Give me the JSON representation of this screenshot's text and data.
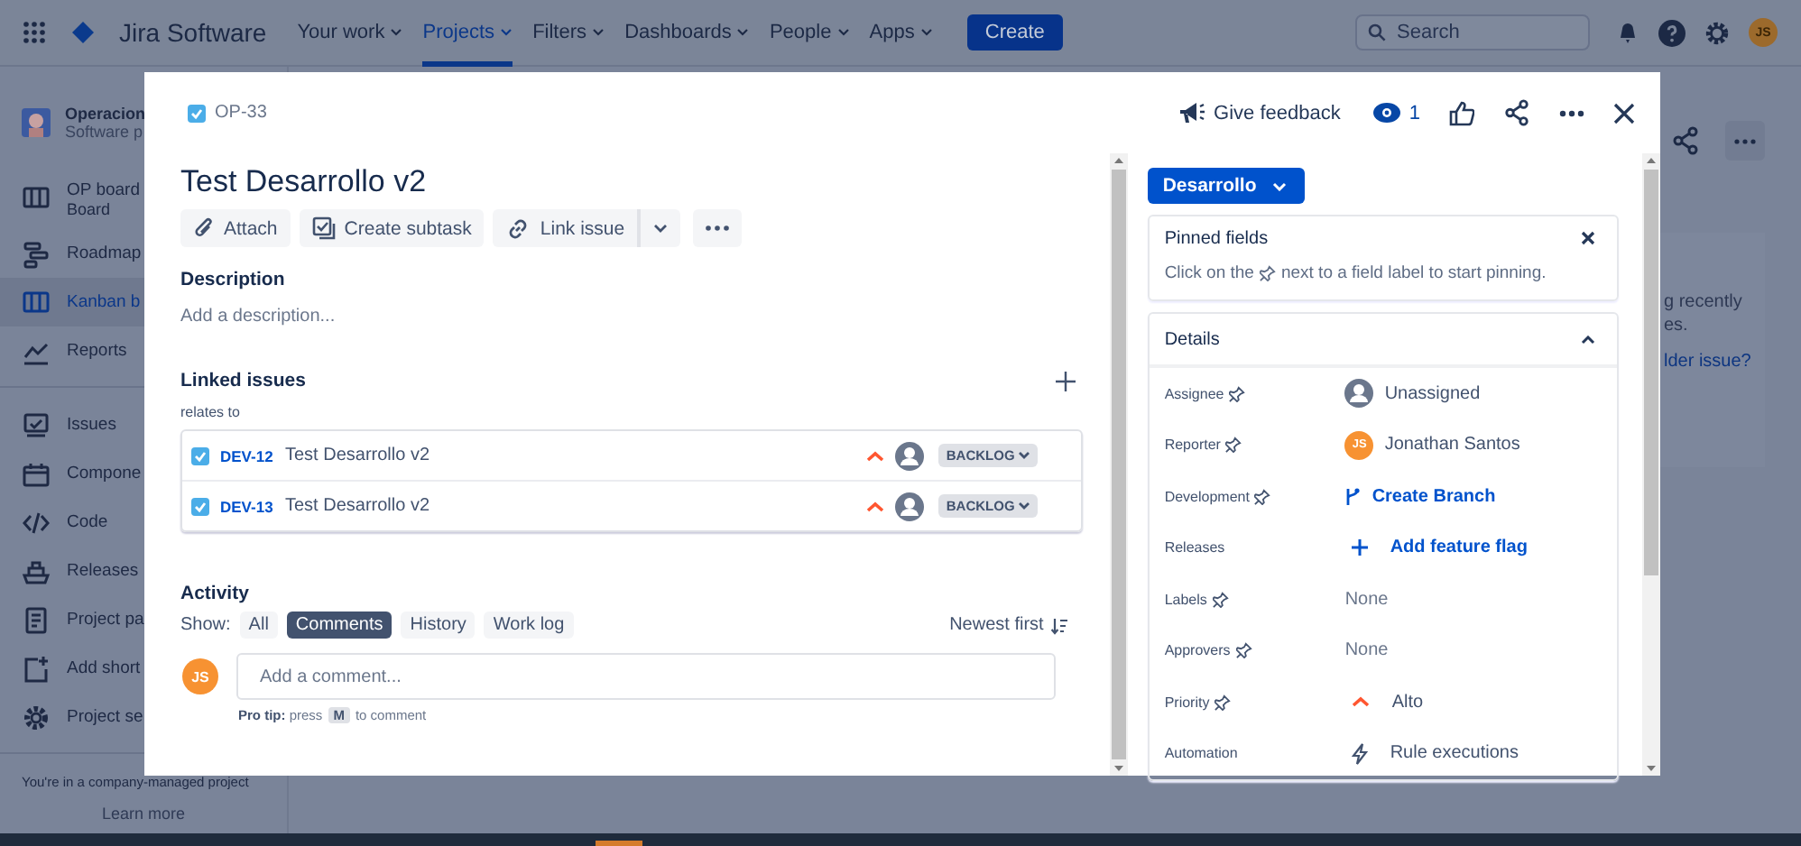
{
  "nav": {
    "logo": "Jira Software",
    "items": [
      {
        "label": "Your work",
        "selected": false
      },
      {
        "label": "Projects",
        "selected": true
      },
      {
        "label": "Filters",
        "selected": false
      },
      {
        "label": "Dashboards",
        "selected": false
      },
      {
        "label": "People",
        "selected": false
      },
      {
        "label": "Apps",
        "selected": false
      }
    ],
    "create": "Create",
    "search": {
      "placeholder": "Search"
    },
    "avatar": "JS"
  },
  "sidebar": {
    "project": {
      "name": "Operacion",
      "type": "Software p"
    },
    "sections": [
      {
        "items": [
          {
            "label": "OP board",
            "sublabel": "Board",
            "selected": false
          },
          {
            "label": "Roadmap",
            "selected": false
          },
          {
            "label": "Kanban b",
            "selected": true
          },
          {
            "label": "Reports",
            "selected": false
          }
        ]
      },
      {
        "items": [
          {
            "label": "Issues",
            "selected": false
          },
          {
            "label": "Compone",
            "selected": false
          },
          {
            "label": "Code",
            "selected": false
          },
          {
            "label": "Releases",
            "selected": false
          },
          {
            "label": "Project pa",
            "selected": false
          },
          {
            "label": "Add short",
            "selected": false
          },
          {
            "label": "Project se",
            "selected": false
          }
        ]
      }
    ],
    "footer": "You're in a company-managed project",
    "learn_more": "Learn more"
  },
  "backdrop_panel": {
    "lines": [
      "g recently",
      "es."
    ],
    "link": "lder issue?"
  },
  "modal": {
    "issue_key": "OP-33",
    "feedback": "Give feedback",
    "watchers": "1",
    "title": "Test Desarrollo v2",
    "actions": [
      "Attach",
      "Create subtask",
      "Link issue"
    ],
    "description": {
      "heading": "Description",
      "placeholder": "Add a description..."
    },
    "linked": {
      "heading": "Linked issues",
      "relation": "relates to",
      "issues": [
        {
          "key": "DEV-12",
          "summary": "Test Desarrollo v2",
          "status": "BACKLOG"
        },
        {
          "key": "DEV-13",
          "summary": "Test Desarrollo v2",
          "status": "BACKLOG"
        }
      ]
    },
    "activity": {
      "heading": "Activity",
      "show_label": "Show:",
      "filters": [
        {
          "label": "All",
          "selected": false
        },
        {
          "label": "Comments",
          "selected": true
        },
        {
          "label": "History",
          "selected": false
        },
        {
          "label": "Work log",
          "selected": false
        }
      ],
      "sort": "Newest first",
      "avatar": "JS",
      "comment_placeholder": "Add a comment...",
      "tip_lead": "**Pro tip:** press",
      "tip_key": "M",
      "tip_tail": "to comment"
    },
    "status": "Desarrollo",
    "pinned": {
      "title": "Pinned fields",
      "text_before": "Click on the",
      "text_after": "next to a field label to start pinning."
    },
    "details": {
      "title": "Details",
      "expanded": true,
      "fields": [
        {
          "label": "Assignee",
          "pinnable": true,
          "kind": "unassigned",
          "value": "Unassigned"
        },
        {
          "label": "Reporter",
          "pinnable": true,
          "kind": "person",
          "avatar": "JS",
          "value": "Jonathan Santos"
        },
        {
          "label": "Development",
          "pinnable": true,
          "kind": "branch",
          "value": "Create Branch"
        },
        {
          "label": "Releases",
          "pinnable": false,
          "kind": "add",
          "value": "Add feature flag"
        },
        {
          "label": "Labels",
          "pinnable": true,
          "kind": "empty",
          "value": "None"
        },
        {
          "label": "Approvers",
          "pinnable": true,
          "kind": "empty",
          "value": "None"
        },
        {
          "label": "Priority",
          "pinnable": true,
          "kind": "priority",
          "value": "Alto"
        },
        {
          "label": "Automation",
          "pinnable": false,
          "kind": "automation",
          "value": "Rule executions"
        }
      ]
    }
  }
}
